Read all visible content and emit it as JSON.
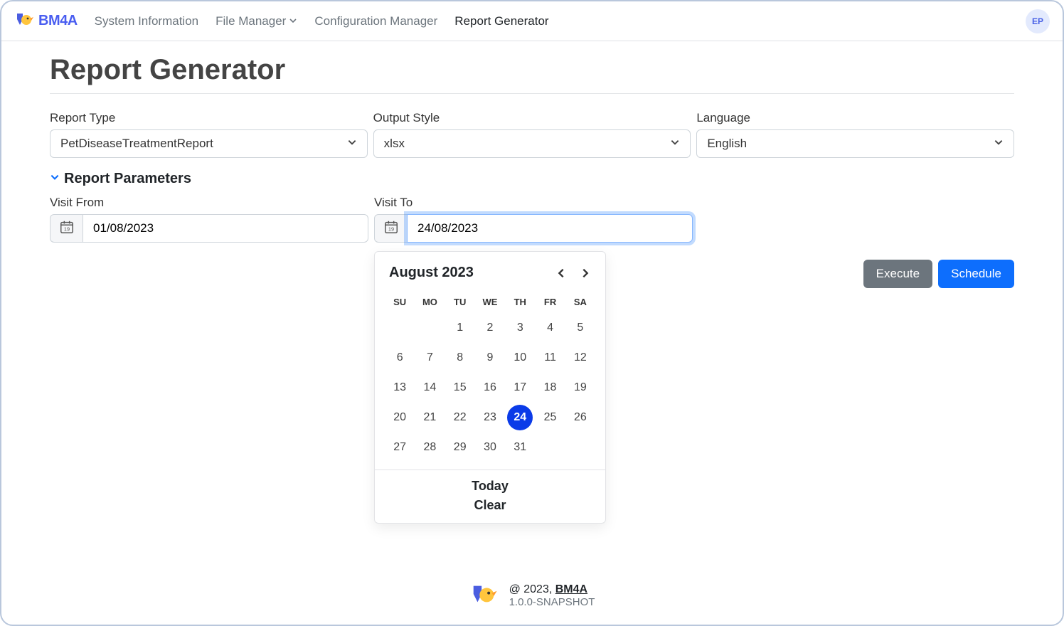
{
  "brand": {
    "text": "BM4A"
  },
  "nav": {
    "items": [
      "System Information",
      "File Manager",
      "Configuration Manager",
      "Report Generator"
    ],
    "fileManagerHasDropdown": true,
    "activeIndex": 3
  },
  "avatar": "EP",
  "page": {
    "title": "Report Generator"
  },
  "fields": {
    "reportType": {
      "label": "Report Type",
      "value": "PetDiseaseTreatmentReport"
    },
    "outputStyle": {
      "label": "Output Style",
      "value": "xlsx"
    },
    "language": {
      "label": "Language",
      "value": "English"
    }
  },
  "paramsSection": {
    "title": "Report Parameters"
  },
  "params": {
    "visitFrom": {
      "label": "Visit From",
      "value": "01/08/2023"
    },
    "visitTo": {
      "label": "Visit To",
      "value": "24/08/2023"
    }
  },
  "actions": {
    "execute": "Execute",
    "schedule": "Schedule"
  },
  "datepicker": {
    "monthLabel": "August 2023",
    "dow": [
      "SU",
      "MO",
      "TU",
      "WE",
      "TH",
      "FR",
      "SA"
    ],
    "leadingBlanks": 2,
    "daysInMonth": 31,
    "selectedDay": 24,
    "todayLabel": "Today",
    "clearLabel": "Clear"
  },
  "footer": {
    "copyright": "@ 2023, ",
    "link": "BM4A",
    "version": "1.0.0-SNAPSHOT"
  }
}
